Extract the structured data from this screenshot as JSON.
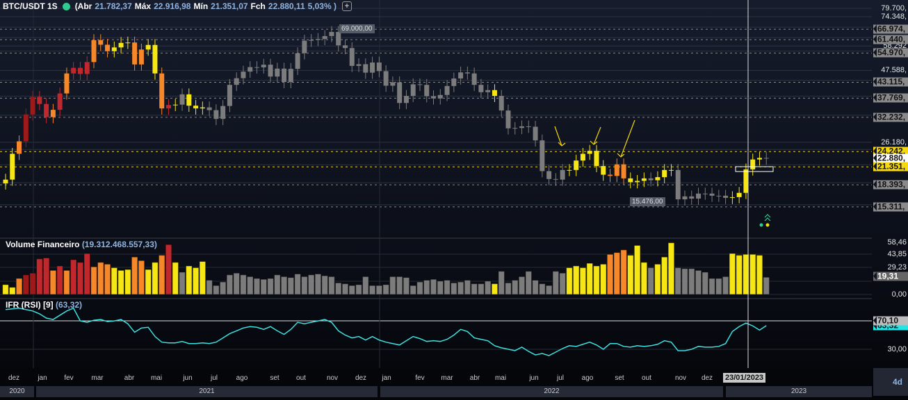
{
  "header": {
    "symbol": "BTC/USDT 1S",
    "open_label": "(Abr",
    "open": "21.782,37",
    "high_label": "Máx",
    "high": "22.916,98",
    "low_label": "Mín",
    "low": "21.351,07",
    "close_label": "Fch",
    "close": "22.880,11",
    "change": "5,03% )"
  },
  "volume_pane": {
    "title": "Volume Financeiro",
    "value": "(19.312.468.557,33)"
  },
  "rsi_pane": {
    "title": "IFR (RSI) [9]",
    "value": "(63,32)"
  },
  "price_axis": {
    "labels": [
      {
        "text": "79.700,",
        "price": 79700
      },
      {
        "text": "74.348,",
        "price": 74348
      },
      {
        "text": "58.292",
        "price": 58292
      },
      {
        "text": "47.588,",
        "price": 47588
      },
      {
        "text": "26.180,",
        "price": 26180
      }
    ],
    "level_tags": [
      {
        "text": "66.974,",
        "price": 66974,
        "style": "gray"
      },
      {
        "text": "61.440,",
        "price": 61440,
        "style": "gray"
      },
      {
        "text": "54.970,",
        "price": 54970,
        "style": "gray"
      },
      {
        "text": "43.115,",
        "price": 43115,
        "style": "gray"
      },
      {
        "text": "37.769,",
        "price": 37769,
        "style": "gray"
      },
      {
        "text": "32.232,",
        "price": 32232,
        "style": "gray"
      },
      {
        "text": "24.242,",
        "price": 24242,
        "style": "yellow"
      },
      {
        "text": "22.880,",
        "price": 22880,
        "style": "white"
      },
      {
        "text": "21.351,",
        "price": 21351,
        "style": "yellow"
      },
      {
        "text": "18.393,",
        "price": 18393,
        "style": "gray"
      },
      {
        "text": "15.311,",
        "price": 15311,
        "style": "gray"
      }
    ]
  },
  "volume_axis": [
    "58,46",
    "43,85",
    "29,23",
    "0,00"
  ],
  "volume_tag": "19,31",
  "rsi_axis": {
    "upper_tag": "70,10",
    "current_tag": "63,32",
    "lower": "30,00"
  },
  "annotations": {
    "high_note": "69.000,00",
    "low_note": "15.476,00"
  },
  "time_axis": {
    "months": [
      "dez",
      "jan",
      "fev",
      "mar",
      "abr",
      "mai",
      "jun",
      "jul",
      "ago",
      "set",
      "out",
      "nov",
      "dez",
      "jan",
      "fev",
      "mar",
      "abr",
      "mai",
      "jun",
      "jul",
      "ago",
      "set",
      "out",
      "nov",
      "dez"
    ],
    "years": [
      "2020",
      "2021",
      "2022",
      "2023"
    ],
    "crosshair_date": "23/01/2023",
    "period": "4d"
  },
  "colors": {
    "y": "#f5e614",
    "o": "#f7882a",
    "r": "#c0282d",
    "d": "#9e1a1a",
    "g": "#7c7c7c",
    "rsi": "#3fe0e0"
  },
  "chart_data": {
    "type": "candlestick",
    "title": "BTC/USDT 1S",
    "scale": "log",
    "ylim": [
      15000,
      79700
    ],
    "close_thousands": [
      19.2,
      23.8,
      26.4,
      33.0,
      38.2,
      36.0,
      32.3,
      34.3,
      39.3,
      46.4,
      48.6,
      46.2,
      51.0,
      61.2,
      58.9,
      55.8,
      57.6,
      59.8,
      60.0,
      50.0,
      56.6,
      58.8,
      46.4,
      34.7,
      35.7,
      35.8,
      39.0,
      35.5,
      34.7,
      35.0,
      34.2,
      31.8,
      35.4,
      42.2,
      44.6,
      47.1,
      48.9,
      48.8,
      49.9,
      45.2,
      48.3,
      43.2,
      48.2,
      54.9,
      60.9,
      61.3,
      61.8,
      63.3,
      65.5,
      58.6,
      57.3,
      49.4,
      50.1,
      46.7,
      50.8,
      47.3,
      41.9,
      43.1,
      36.3,
      38.5,
      42.4,
      42.2,
      38.4,
      37.7,
      38.8,
      41.8,
      44.5,
      46.8,
      46.4,
      42.2,
      39.7,
      40.4,
      38.5,
      34.1,
      29.4,
      29.5,
      29.9,
      29.8,
      26.6,
      20.6,
      19.3,
      19.2,
      20.8,
      20.8,
      22.5,
      23.8,
      24.4,
      21.5,
      20.0,
      19.8,
      21.8,
      19.4,
      18.8,
      19.0,
      19.4,
      19.1,
      19.6,
      20.8,
      20.8,
      16.3,
      16.7,
      16.4,
      17.1,
      17.1,
      16.8,
      16.8,
      16.5,
      16.6,
      17.2,
      20.9,
      22.7,
      23.0,
      22.88
    ],
    "color_codes": "yyoddrrororrroooyyyooyyorygyyyggggggggggggggggggggggggggggggggggggggggggyggggggggggyyyyyyoooyyygyyyggggggggyyyyyg",
    "volume_billions": [
      11,
      8,
      18,
      22,
      24,
      40,
      41,
      27,
      32,
      27,
      39,
      36,
      46,
      31,
      36,
      34,
      30,
      27,
      28,
      42,
      38,
      28,
      36,
      44,
      56,
      36,
      25,
      32,
      30,
      37,
      16,
      10,
      14,
      22,
      24,
      22,
      20,
      18,
      17,
      18,
      22,
      20,
      19,
      23,
      20,
      22,
      23,
      21,
      20,
      13,
      12,
      10,
      11,
      20,
      10,
      10,
      11,
      20,
      20,
      19,
      10,
      14,
      16,
      17,
      15,
      16,
      13,
      14,
      16,
      12,
      12,
      15,
      12,
      26,
      13,
      16,
      20,
      26,
      16,
      12,
      10,
      26,
      24,
      30,
      32,
      30,
      35,
      32,
      34,
      45,
      47,
      50,
      44,
      55,
      36,
      30,
      34,
      42,
      58,
      30,
      29,
      29,
      27,
      25,
      18,
      18,
      20,
      46,
      44,
      45,
      45,
      44,
      19.31
    ],
    "volume_ylim": [
      0,
      58.46
    ],
    "rsi": [
      86,
      87,
      88,
      86,
      84,
      80,
      74,
      72,
      78,
      84,
      88,
      70,
      68,
      71,
      72,
      69,
      70,
      72,
      66,
      54,
      60,
      61,
      48,
      40,
      39,
      39,
      41,
      38,
      38,
      39,
      38,
      40,
      46,
      52,
      56,
      60,
      62,
      61,
      58,
      62,
      56,
      51,
      58,
      68,
      66,
      68,
      70,
      72,
      68,
      56,
      50,
      46,
      48,
      43,
      48,
      43,
      40,
      38,
      36,
      42,
      48,
      45,
      41,
      42,
      41,
      44,
      50,
      58,
      55,
      46,
      44,
      42,
      35,
      32,
      30,
      28,
      33,
      27,
      22,
      24,
      21,
      26,
      31,
      35,
      34,
      37,
      40,
      36,
      30,
      38,
      38,
      34,
      33,
      35,
      34,
      35,
      37,
      42,
      40,
      28,
      28,
      30,
      34,
      33,
      33,
      34,
      38,
      55,
      62,
      67,
      63,
      57,
      63.32
    ],
    "rsi_levels": [
      70.1,
      30.0
    ]
  }
}
